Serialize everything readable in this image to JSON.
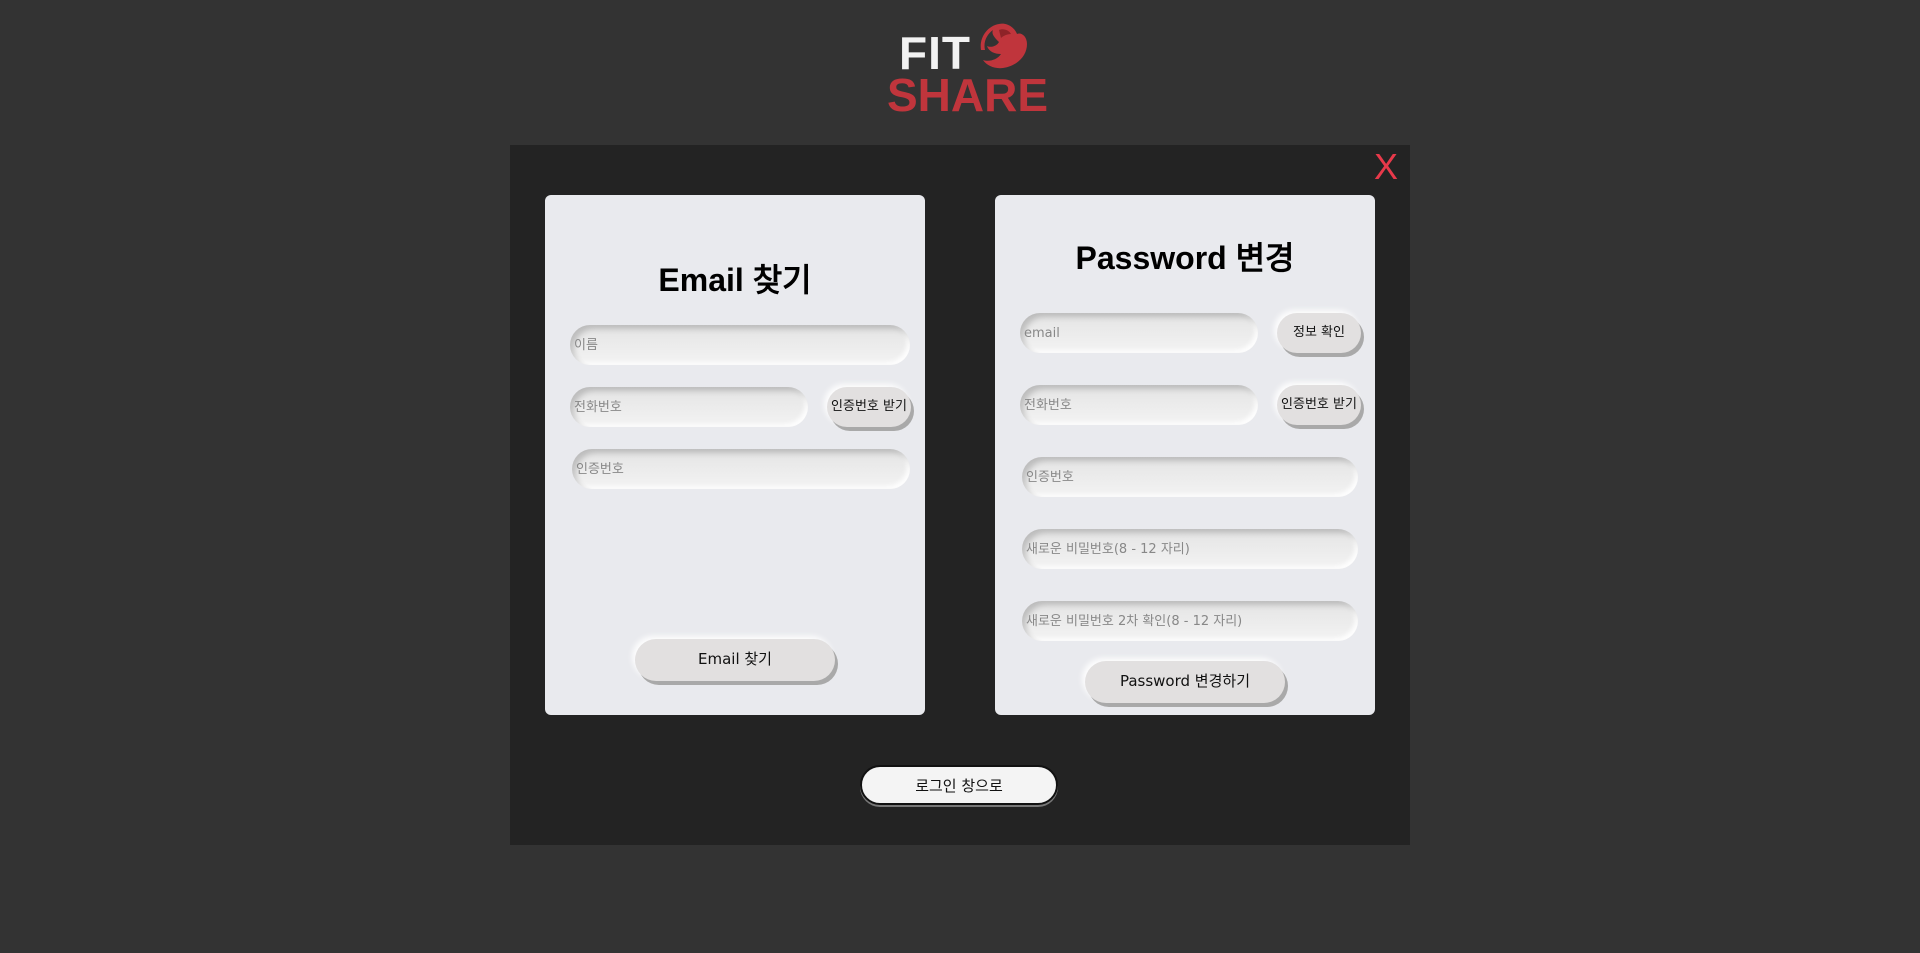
{
  "brand": {
    "line1": "FIT",
    "line2": "SHARE",
    "icon": "flexed-arm-icon",
    "primary_color": "#c0353c"
  },
  "modal": {
    "close_label": "X"
  },
  "email_find": {
    "title": "Email 찾기",
    "name_placeholder": "이름",
    "phone_placeholder": "전화번호",
    "code_button": "인증번호 받기",
    "code_placeholder": "인증번호",
    "submit_label": "Email 찾기"
  },
  "password_change": {
    "title": "Password 변경",
    "email_placeholder": "email",
    "verify_button": "정보 확인",
    "phone_placeholder": "전화번호",
    "code_button": "인증번호 받기",
    "code_placeholder": "인증번호",
    "new_password_placeholder": "새로운 비밀번호(8 - 12 자리)",
    "confirm_password_placeholder": "새로운 비밀번호 2차 확인(8 - 12 자리)",
    "submit_label": "Password 변경하기"
  },
  "back_label": "로그인 창으로"
}
